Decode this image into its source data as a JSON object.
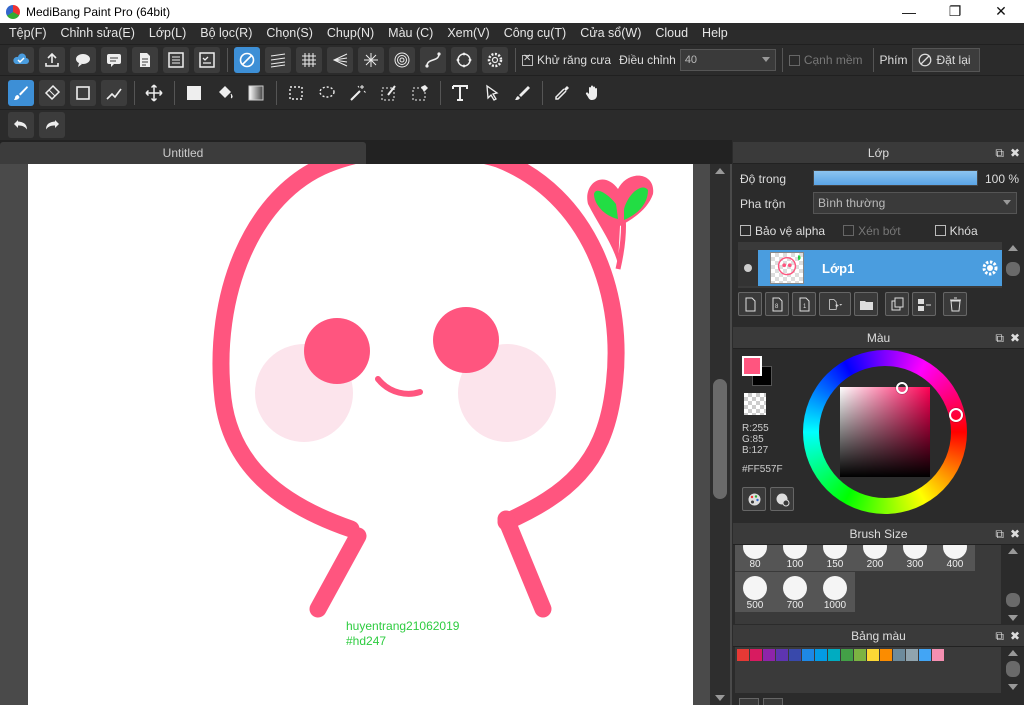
{
  "window": {
    "title": "MediBang Paint Pro (64bit)",
    "minimize": "—",
    "maximize": "❐",
    "close": "✕"
  },
  "menu": [
    "Tệp(F)",
    "Chỉnh sửa(E)",
    "Lớp(L)",
    "Bộ lọc(R)",
    "Chọn(S)",
    "Chụp(N)",
    "Màu (C)",
    "Xem(V)",
    "Công cụ(T)",
    "Cửa sổ(W)",
    "Cloud",
    "Help"
  ],
  "toolbar1": {
    "antialias_label": "Khử răng cưa",
    "adjust_label": "Điều chỉnh",
    "adjust_value": "40",
    "soft_edge_label": "Cạnh mềm",
    "key_label": "Phím",
    "reset_label": "Đặt lại"
  },
  "document": {
    "tab_title": "Untitled"
  },
  "canvas_text": {
    "line1": "huyentrang21062019",
    "line2": "#hd247"
  },
  "layer_panel": {
    "title": "Lớp",
    "opacity_label": "Độ trong",
    "opacity_value": "100 %",
    "opacity_fraction": 1.0,
    "blend_label": "Pha trộn",
    "blend_value": "Bình thường",
    "protect_alpha": "Bảo vệ alpha",
    "clipping": "Xén bớt",
    "lock": "Khóa",
    "layer_name": "Lớp1"
  },
  "color_panel": {
    "title": "Màu",
    "foreground_color": "#FF557F",
    "r": "R:255",
    "g": "G:85",
    "b": "B:127",
    "hex": "#FF557F"
  },
  "brush_panel": {
    "title": "Brush Size",
    "sizes_row1": [
      "80",
      "100",
      "150",
      "200",
      "300",
      "400"
    ],
    "sizes_row2": [
      "500",
      "700",
      "1000"
    ]
  },
  "palette_panel": {
    "title": "Bảng màu",
    "swatches": [
      "#e53935",
      "#d81b60",
      "#8e24aa",
      "#5e35b1",
      "#3949ab",
      "#1e88e5",
      "#039be5",
      "#00acc1",
      "#43a047",
      "#7cb342",
      "#fdd835",
      "#fb8c00",
      "#6d8b9c",
      "#90a4ae",
      "#42a5f5",
      "#f48fb1"
    ]
  },
  "colors": {
    "accent": "#3d8fd6",
    "drawing_pink": "#FF557F",
    "sprout_green": "#22dd44",
    "blush": "#fce4ec",
    "signature_green": "#2ecc40"
  }
}
